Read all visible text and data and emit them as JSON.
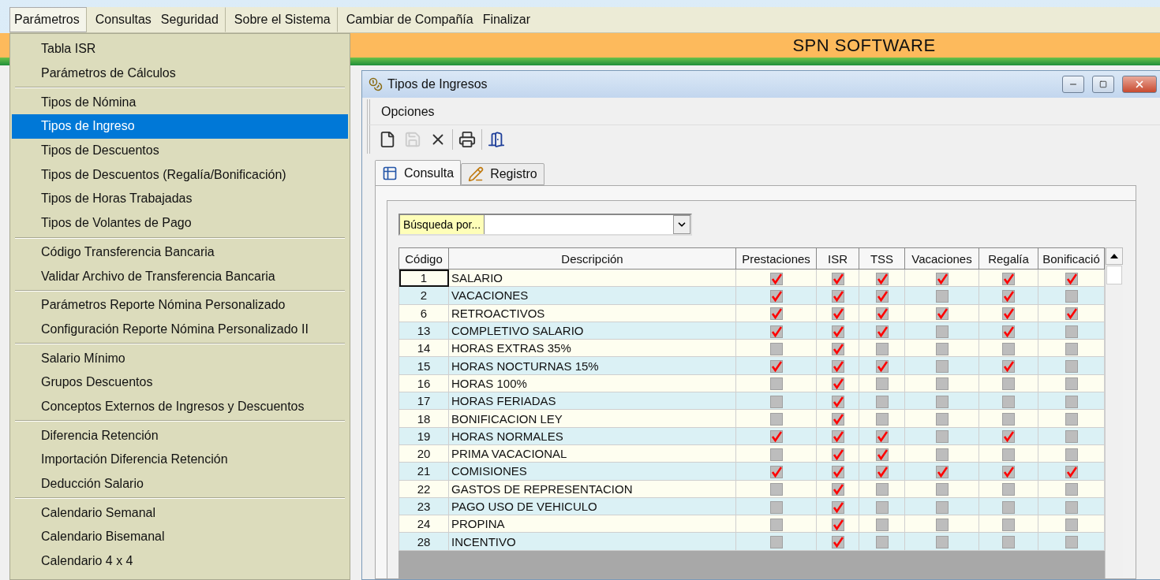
{
  "menubar": [
    {
      "label": "Parámetros",
      "selected": true
    },
    {
      "label": "Consultas",
      "selected": false
    },
    {
      "label": "Seguridad",
      "selected": false
    },
    {
      "label": "Sobre el Sistema",
      "selected": false
    },
    {
      "label": "Cambiar de Compañía",
      "selected": false
    },
    {
      "label": "Finalizar",
      "selected": false
    }
  ],
  "dropdown": [
    {
      "items": [
        {
          "label": "Tabla  ISR",
          "selected": false
        },
        {
          "label": "Parámetros de Cálculos",
          "selected": false
        }
      ]
    },
    {
      "items": [
        {
          "label": "Tipos de Nómina",
          "selected": false
        },
        {
          "label": "Tipos de Ingreso",
          "selected": true
        },
        {
          "label": "Tipos de Descuentos",
          "selected": false
        },
        {
          "label": "Tipos de Descuentos (Regalía/Bonificación)",
          "selected": false
        },
        {
          "label": "Tipos de Horas Trabajadas",
          "selected": false
        },
        {
          "label": "Tipos de Volantes de Pago",
          "selected": false
        }
      ]
    },
    {
      "items": [
        {
          "label": "Código Transferencia Bancaria",
          "selected": false
        },
        {
          "label": "Validar Archivo de Transferencia Bancaria",
          "selected": false
        }
      ]
    },
    {
      "items": [
        {
          "label": "Parámetros Reporte Nómina Personalizado",
          "selected": false
        },
        {
          "label": "Configuración Reporte Nómina Personalizado II",
          "selected": false
        }
      ]
    },
    {
      "items": [
        {
          "label": "Salario Mínimo",
          "selected": false
        },
        {
          "label": "Grupos Descuentos",
          "selected": false
        },
        {
          "label": "Conceptos Externos de Ingresos y Descuentos",
          "selected": false
        }
      ]
    },
    {
      "items": [
        {
          "label": "Diferencia Retención",
          "selected": false
        },
        {
          "label": "Importación Diferencia Retención",
          "selected": false
        },
        {
          "label": "Deducción Salario",
          "selected": false
        }
      ]
    },
    {
      "items": [
        {
          "label": "Calendario Semanal",
          "selected": false
        },
        {
          "label": "Calendario Bisemanal",
          "selected": false
        },
        {
          "label": "Calendario 4 x 4",
          "selected": false
        }
      ]
    }
  ],
  "banner": {
    "title": "SPN SOFTWARE"
  },
  "window": {
    "title": "Tipos de Ingresos",
    "menu": [
      "Opciones"
    ],
    "toolbar": [
      {
        "kind": "new",
        "disabled": false
      },
      {
        "kind": "save",
        "disabled": true
      },
      {
        "kind": "delete",
        "disabled": false
      },
      {
        "kind": "print",
        "disabled": false
      },
      {
        "kind": "exit",
        "disabled": false
      }
    ],
    "tabs": [
      {
        "label": "Consulta",
        "kind": "list",
        "selected": true
      },
      {
        "label": "Registro",
        "kind": "edit",
        "selected": false
      }
    ],
    "search": {
      "label": "Búsqueda por..."
    },
    "table": {
      "columns": [
        "Código",
        "Descripción",
        "Prestaciones",
        "ISR",
        "TSS",
        "Vacaciones",
        "Regalía",
        "Bonificació"
      ],
      "rows": [
        {
          "code": "1",
          "description": "SALARIO",
          "selected": true,
          "checks": [
            true,
            true,
            true,
            true,
            true,
            true
          ]
        },
        {
          "code": "2",
          "description": "VACACIONES",
          "selected": false,
          "checks": [
            true,
            true,
            true,
            false,
            true,
            false
          ]
        },
        {
          "code": "6",
          "description": "RETROACTIVOS",
          "selected": false,
          "checks": [
            true,
            true,
            true,
            true,
            true,
            true
          ]
        },
        {
          "code": "13",
          "description": "COMPLETIVO SALARIO",
          "selected": false,
          "checks": [
            true,
            true,
            true,
            false,
            true,
            false
          ]
        },
        {
          "code": "14",
          "description": "HORAS EXTRAS 35%",
          "selected": false,
          "checks": [
            false,
            true,
            false,
            false,
            false,
            false
          ]
        },
        {
          "code": "15",
          "description": "HORAS NOCTURNAS 15%",
          "selected": false,
          "checks": [
            true,
            true,
            true,
            false,
            true,
            false
          ]
        },
        {
          "code": "16",
          "description": "HORAS 100%",
          "selected": false,
          "checks": [
            false,
            true,
            false,
            false,
            false,
            false
          ]
        },
        {
          "code": "17",
          "description": "HORAS FERIADAS",
          "selected": false,
          "checks": [
            false,
            true,
            false,
            false,
            false,
            false
          ]
        },
        {
          "code": "18",
          "description": "BONIFICACION LEY",
          "selected": false,
          "checks": [
            false,
            true,
            false,
            false,
            false,
            false
          ]
        },
        {
          "code": "19",
          "description": "HORAS NORMALES",
          "selected": false,
          "checks": [
            true,
            true,
            true,
            false,
            true,
            false
          ]
        },
        {
          "code": "20",
          "description": "PRIMA VACACIONAL",
          "selected": false,
          "checks": [
            false,
            true,
            true,
            false,
            false,
            false
          ]
        },
        {
          "code": "21",
          "description": "COMISIONES",
          "selected": false,
          "checks": [
            true,
            true,
            true,
            true,
            true,
            true
          ]
        },
        {
          "code": "22",
          "description": "GASTOS DE REPRESENTACION",
          "selected": false,
          "checks": [
            false,
            true,
            false,
            false,
            false,
            false
          ]
        },
        {
          "code": "23",
          "description": "PAGO USO DE VEHICULO",
          "selected": false,
          "checks": [
            false,
            true,
            false,
            false,
            false,
            false
          ]
        },
        {
          "code": "24",
          "description": "PROPINA",
          "selected": false,
          "checks": [
            false,
            true,
            false,
            false,
            false,
            false
          ]
        },
        {
          "code": "28",
          "description": "INCENTIVO",
          "selected": false,
          "checks": [
            false,
            true,
            false,
            false,
            false,
            false
          ]
        }
      ]
    }
  }
}
